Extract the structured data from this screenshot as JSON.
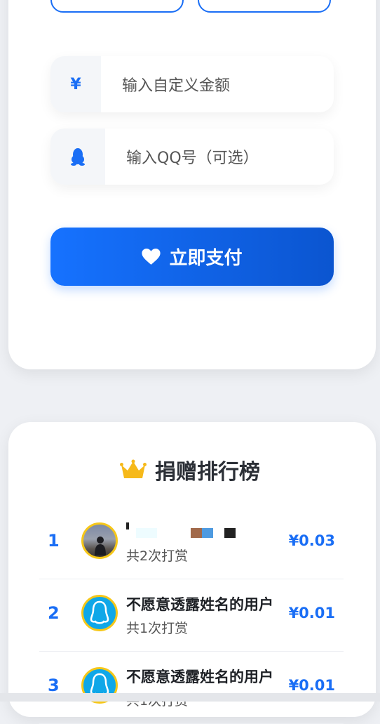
{
  "form": {
    "custom_amount": {
      "icon": "yen-icon",
      "icon_glyph": "¥",
      "placeholder": "输入自定义金额"
    },
    "qq": {
      "icon": "qq-penguin-icon",
      "placeholder": "输入QQ号（可选）"
    },
    "pay_button": {
      "icon": "heart-icon",
      "label": "立即支付"
    }
  },
  "ranking": {
    "icon": "crown-icon",
    "title": "捐赠排行榜",
    "rows": [
      {
        "rank": "1",
        "name": "",
        "times": "共2次打赏",
        "amount": "¥0.03"
      },
      {
        "rank": "2",
        "name": "不愿意透露姓名的用户",
        "times": "共1次打赏",
        "amount": "¥0.01"
      },
      {
        "rank": "3",
        "name": "不愿意透露姓名的用户",
        "times": "共1次打赏",
        "amount": "¥0.01"
      }
    ]
  },
  "colors": {
    "accent": "#1a6ef5",
    "crown": "#f6b91a",
    "avatar_ring": "#f6c719",
    "qq_avatar_bg": "#0fa7e8"
  }
}
